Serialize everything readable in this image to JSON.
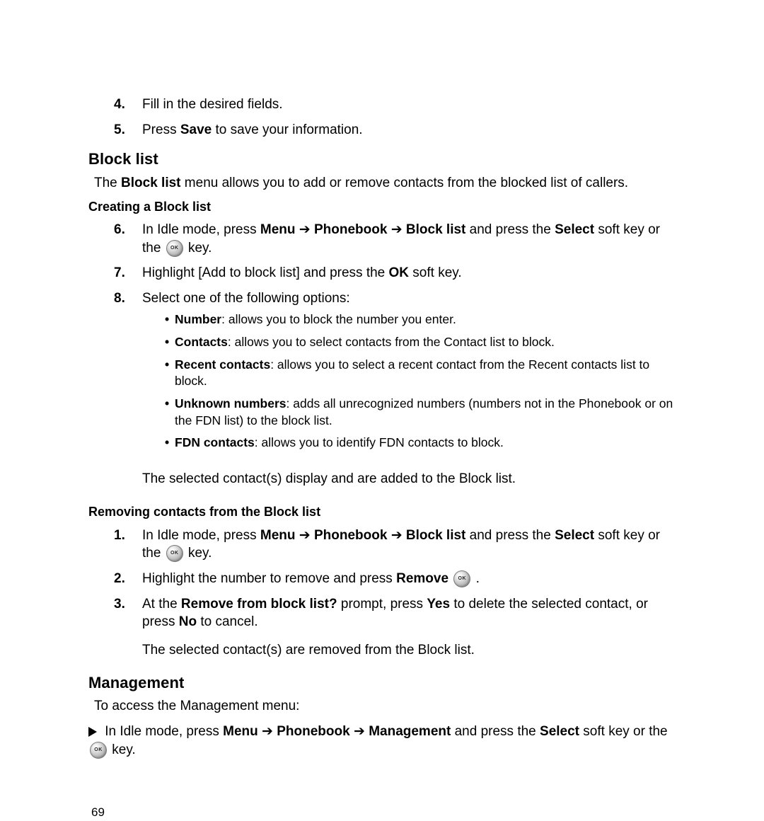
{
  "top_steps": [
    {
      "n": "4.",
      "text_pre": "Fill in the desired fields."
    },
    {
      "n": "5.",
      "text_pre": "Press ",
      "bold": "Save",
      "text_post": " to save your information."
    }
  ],
  "block_list": {
    "heading": "Block list",
    "intro_pre": "The ",
    "intro_bold": "Block list",
    "intro_post": " menu allows you to add or remove contacts from the blocked list of callers.",
    "creating_heading": "Creating a Block list",
    "step6": {
      "n": "6.",
      "pre": "In Idle mode, press ",
      "b1": "Menu",
      "mid1": " ➔ ",
      "b2": "Phonebook",
      "mid2": " ➔ ",
      "b3": "Block list",
      "mid3": " and press the ",
      "b4": "Select",
      "post": " soft key or the ",
      " tail": " key."
    },
    "step7": {
      "n": "7.",
      "pre": "Highlight [Add to block list] and press the ",
      "b": "OK",
      "post": " soft key."
    },
    "step8": {
      "n": "8.",
      "text": "Select one of the following options:"
    },
    "bullets": [
      {
        "b": "Number",
        "t": ": allows you to block the number you enter."
      },
      {
        "b": "Contacts",
        "t": ": allows you to select contacts from the Contact list to block."
      },
      {
        "b": "Recent contacts",
        "t": ": allows you to select a recent contact from the Recent contacts list to block."
      },
      {
        "b": "Unknown numbers",
        "t": ": adds all unrecognized numbers (numbers not in the Phonebook or on the FDN list) to the block list."
      },
      {
        "b": "FDN contacts",
        "t": ": allows you to identify FDN contacts to block."
      }
    ],
    "after": "The selected contact(s) display and are added to the Block list.",
    "removing_heading": "Removing contacts from the Block list",
    "r1": {
      "n": "1.",
      "pre": "In Idle mode, press ",
      "b1": "Menu",
      "mid1": " ➔ ",
      "b2": "Phonebook",
      "mid2": " ➔ ",
      "b3": "Block list",
      "mid3": " and press the ",
      "b4": "Select",
      "post": " soft key or the ",
      "tail": " key."
    },
    "r2": {
      "n": "2.",
      "pre": "Highlight the number to remove and press ",
      "b": "Remove",
      "post": " ."
    },
    "r3": {
      "n": "3.",
      "pre": "At the ",
      "b1": "Remove from block list?",
      "mid": " prompt, press ",
      "b2": "Yes",
      "mid2": " to delete the selected contact, or press ",
      "b3": "No",
      "post": " to cancel."
    },
    "r_after": "The selected contact(s) are removed from the Block list."
  },
  "management": {
    "heading": "Management",
    "intro": "To access the Management menu:",
    "line": {
      "pre": "In Idle mode, press ",
      "b1": "Menu",
      "mid1": " ➔ ",
      "b2": "Phonebook",
      "mid2": " ➔ ",
      "b3": "Management",
      "mid3": " and press the ",
      "b4": "Select",
      "post": " soft key or the ",
      "tail": " key."
    }
  },
  "page_number": "69"
}
